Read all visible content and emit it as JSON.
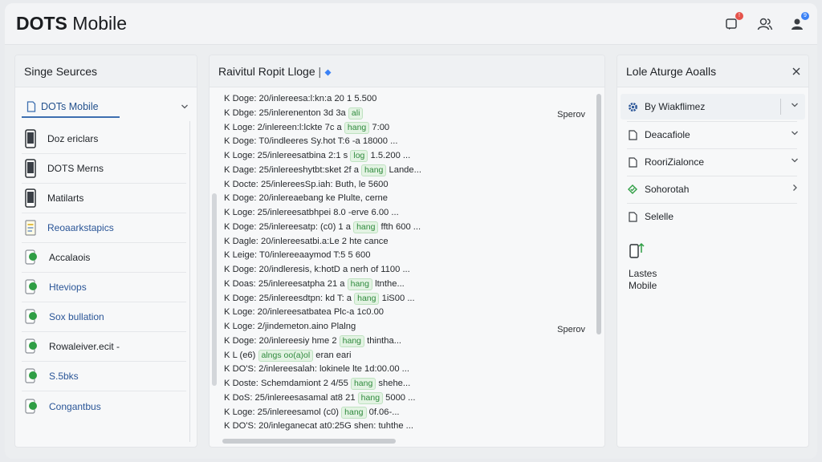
{
  "header": {
    "title_bold": "DOTS",
    "title_rest": " Mobile",
    "notification_badge": "!",
    "account_badge": "9"
  },
  "left_panel": {
    "title": "Singe Seurces",
    "selector_label": "DOTs Mobile",
    "items": [
      {
        "label": "Doz ericlars",
        "icon": "phone-icon"
      },
      {
        "label": "DOTS Merns",
        "icon": "phone-icon"
      },
      {
        "label": "Matilarts",
        "icon": "phone-icon"
      },
      {
        "label": "Reoaarkstapics",
        "icon": "document-icon"
      },
      {
        "label": "Accalaois",
        "icon": "chat-icon"
      },
      {
        "label": "Hteviops",
        "icon": "chat-icon"
      },
      {
        "label": "Sox bullation",
        "icon": "chat-icon"
      },
      {
        "label": "Rowaleiver.ecit -",
        "icon": "chat-icon"
      },
      {
        "label": "S.5bks",
        "icon": "chat-icon"
      },
      {
        "label": "Congantbus",
        "icon": "chat-icon"
      }
    ]
  },
  "middle_panel": {
    "title": "Raivitul Ropit Lloge",
    "side_notes": [
      "Sperov",
      "Sperov"
    ],
    "log_lines": [
      {
        "text": "K Doge: 20/inlereesa:l:kn:a 20 ",
        "tag": "",
        "tail": "  1 5.500"
      },
      {
        "text": "K Dbge: 25/inlerenenton 3d 3a ",
        "tag": "ali",
        "tail": ""
      },
      {
        "text": "K Loge: 2/inlereen:l:lckte 7c a ",
        "tag": "hang",
        "tail": " 7:00"
      },
      {
        "text": "K Doge: T0/indleeres Sy.hot T:6 ",
        "tag": "",
        "tail": "-a 18000 ..."
      },
      {
        "text": "K Loge: 25/inlereesatbina 2:1 s ",
        "tag": "log",
        "tail": " 1.5.200 ..."
      },
      {
        "text": "K Dage: 25/inlereeshytbt:sket 2f a ",
        "tag": "hang",
        "tail": " Lande..."
      },
      {
        "text": "K Docte: 25/inlereesSp.iah: Buth, ",
        "tag": "",
        "tail": "le 5600"
      },
      {
        "text": "K Doge: 20/inlereaebang ke Plulte, ",
        "tag": "",
        "tail": "cerne"
      },
      {
        "text": "K Loge: 25/inlereesatbhpei 8.0 ",
        "tag": "",
        "tail": "-erve 6.00 ..."
      },
      {
        "text": "K Doge: 25/inlereesatp: (c0) 1 a ",
        "tag": "hang",
        "tail": " ffth 600 ..."
      },
      {
        "text": "K Dagle: 20/inlereesatbi.a:Le 2 ",
        "tag": "",
        "tail": "hte cance"
      },
      {
        "text": "K Leige: T0/inlereeaaymod T:5 ",
        "tag": "",
        "tail": "5 600"
      },
      {
        "text": "K Doge: 20/indleresis, k:hotD a ",
        "tag": "",
        "tail": "nerh of 1100 ..."
      },
      {
        "text": "K Doas: 25/inlereesatpha 21 a ",
        "tag": "hang",
        "tail": " ltnthe..."
      },
      {
        "text": "K Doge: 25/inlereesdtpn: kd T: a ",
        "tag": "hang",
        "tail": " 1iS00 ..."
      },
      {
        "text": "K Loge: 20/inlereesatbatea Plc-",
        "tag": "",
        "tail": "a 1c0.00"
      },
      {
        "text": "K Loge: 2/jindemeton.aino Plalng",
        "tag": "",
        "tail": ""
      },
      {
        "text": "K Doge: 20/inlereesiy hme 2 ",
        "tag": "hang",
        "tail": " thintha..."
      },
      {
        "text": "K L (e6) ",
        "tag": "alngs oo(a)ol",
        "tail": " eran eari"
      },
      {
        "text": "K DO'S: 2/inlereesalah: lokinele ",
        "tag": "",
        "tail": "lte 1d:00.00 ..."
      },
      {
        "text": "K Doste: Schemdamiont 2 4/55 ",
        "tag": "hang",
        "tail": " shehe..."
      },
      {
        "text": "K DoS: 25/inlereesasamal at8 21 ",
        "tag": "hang",
        "tail": " 5000 ..."
      },
      {
        "text": "K Loge: 25/inlereesamol (c0) ",
        "tag": "hang",
        "tail": " 0f.06-..."
      },
      {
        "text": "K DO'S: 20/inleganecat at0:25G ",
        "tag": "",
        "tail": "shen: tuhthe ..."
      }
    ]
  },
  "right_panel": {
    "title": "Lole Aturge Aoalls",
    "options": [
      {
        "label": "By Wiakflimez",
        "icon": "gear-icon",
        "chevron": "down"
      },
      {
        "label": "Deacafiole",
        "icon": "page-icon",
        "chevron": "down"
      },
      {
        "label": "RooriZialonce",
        "icon": "page-icon",
        "chevron": "down"
      },
      {
        "label": "Sohorotah",
        "icon": "check-shield-icon",
        "chevron": "right"
      },
      {
        "label": "Selelle",
        "icon": "page-icon",
        "chevron": ""
      }
    ],
    "mobile_label_line1": "Lastes",
    "mobile_label_line2": "Mobile"
  },
  "colors": {
    "accent_blue": "#3d6fb0",
    "green": "#2f9e44",
    "badge_red": "#e5534b",
    "badge_blue": "#3b82f6"
  }
}
